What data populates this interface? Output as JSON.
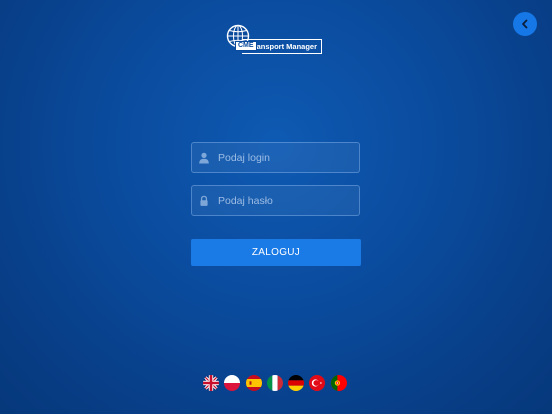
{
  "header": {
    "back_icon": "chevron-left-icon",
    "back_button_color": "#1677e6"
  },
  "logo": {
    "badge": "CME",
    "product": "Transport Manager"
  },
  "form": {
    "login": {
      "placeholder": "Podaj login",
      "value": "",
      "icon": "user-icon"
    },
    "password": {
      "placeholder": "Podaj hasło",
      "value": "",
      "icon": "lock-icon"
    },
    "submit_label": "ZALOGUJ"
  },
  "languages": [
    "english",
    "polish",
    "spanish",
    "italian",
    "german",
    "turkish",
    "portuguese"
  ],
  "colors": {
    "background": "#0a4a9c",
    "accent": "#1a7ae6"
  }
}
